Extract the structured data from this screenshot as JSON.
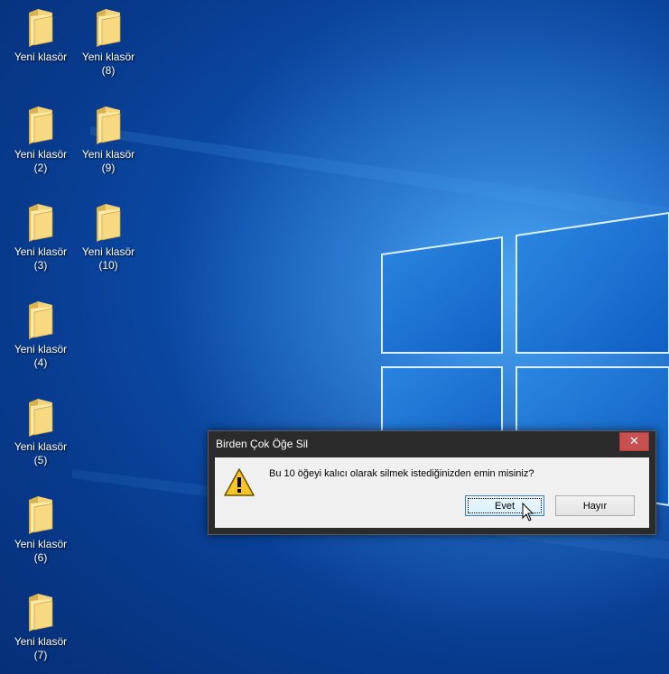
{
  "desktop": {
    "icons": [
      {
        "line1": "Yeni klasör",
        "line2": ""
      },
      {
        "line1": "Yeni klasör",
        "line2": "(2)"
      },
      {
        "line1": "Yeni klasör",
        "line2": "(3)"
      },
      {
        "line1": "Yeni klasör",
        "line2": "(4)"
      },
      {
        "line1": "Yeni klasör",
        "line2": "(5)"
      },
      {
        "line1": "Yeni klasör",
        "line2": "(6)"
      },
      {
        "line1": "Yeni klasör",
        "line2": "(7)"
      },
      {
        "line1": "Yeni klasör",
        "line2": "(8)"
      },
      {
        "line1": "Yeni klasör",
        "line2": "(9)"
      },
      {
        "line1": "Yeni klasör",
        "line2": "(10)"
      }
    ],
    "icon_type": "folder-icon"
  },
  "dialog": {
    "title": "Birden Çok Öğe Sil",
    "close_label": "✕",
    "message": "Bu 10 öğeyi kalıcı olarak silmek istediğinizden emin misiniz?",
    "icon": "warning-icon",
    "yes_label": "Evet",
    "no_label": "Hayır"
  },
  "colors": {
    "wallpaper_blue": "#0b4aa6",
    "close_button_red": "#c75050",
    "dialog_frame": "#2b2b2b"
  }
}
